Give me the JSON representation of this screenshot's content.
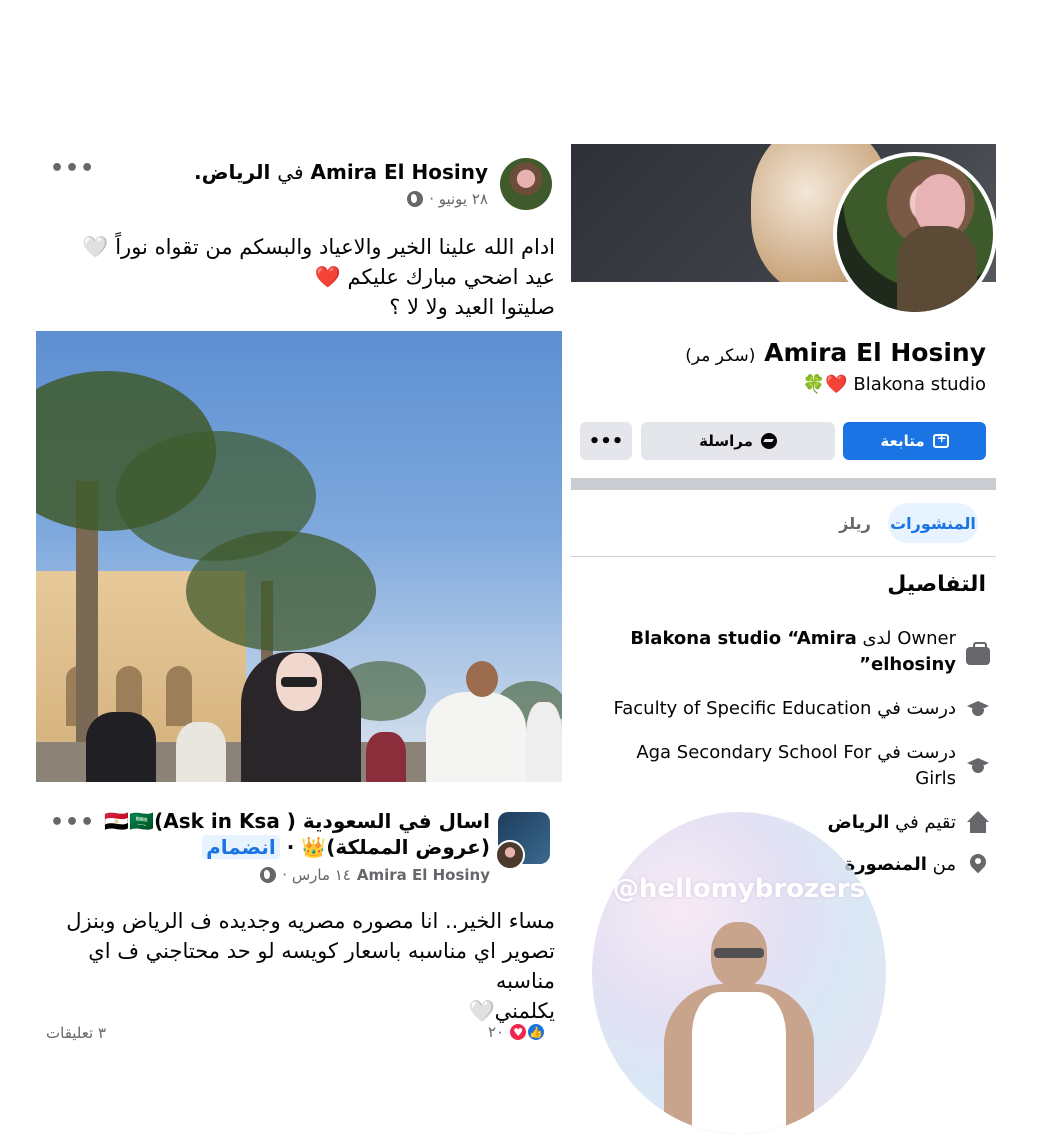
{
  "post1": {
    "author": "Amira El Hosiny",
    "location_prefix": "في",
    "location": "الرياض.",
    "date": "٢٨ يونيو ·",
    "more": "•••",
    "line1": "ادام الله  علينا الخير والاعياد والبسكم من تقواه نوراً",
    "line1_emoji": "🤍",
    "line2": "عيد اضحي مبارك عليكم",
    "line2_emoji": "❤️",
    "line3": "صليتوا العيد ولا لا ؟"
  },
  "post2": {
    "group_name": "اسال في السعودية ( Ask in Ksa)🇪🇬🇸🇦 (عروض المملكة)👑",
    "join_separator": "·",
    "join": "انضمام",
    "author": "Amira El Hosiny",
    "date": "١٤ مارس ·",
    "more": "•••",
    "line1": "مساء الخير.. انا مصوره مصريه وجديده ف الرياض وبنزل",
    "line2": "تصوير اي مناسبه باسعار كويسه لو حد محتاجني ف اي مناسبه",
    "line3": "يكلمني",
    "line3_emoji": "🤍",
    "reaction_count": "٢٠",
    "comments": "٣ تعليقات"
  },
  "profile": {
    "name": "Amira El Hosiny",
    "nickname": "(سكر مر)",
    "bio": "Blakona studio",
    "bio_emoji_heart": "❤️",
    "bio_emoji_clover": "🍀",
    "follow_label": "متابعة",
    "message_label": "مراسلة",
    "more_label": "•••"
  },
  "tabs": {
    "posts": "المنشورات",
    "reels": "ريلز"
  },
  "details": {
    "title": "التفاصيل",
    "work_prefix": "Owner لدى",
    "work_place": "Blakona studio “Amira elhosiny”",
    "edu1_prefix": "درست في",
    "edu1_place": "Faculty of Specific Education",
    "edu2_prefix": "درست في",
    "edu2_place": "Aga Secondary School For Girls",
    "lives_prefix": "تقيم في",
    "lives_place": "الرياض",
    "from_prefix": "من",
    "from_place": "المنصورة"
  },
  "watermark": {
    "handle": "@hellomybrozers"
  },
  "colors": {
    "facebook_blue": "#1b74e4",
    "button_gray": "#e4e6eb",
    "muted_text": "#65676b",
    "love_red": "#f02849"
  },
  "icons": {
    "globe": "globe-icon",
    "briefcase": "briefcase-icon",
    "graduation_cap": "graduation-cap-icon",
    "home": "home-icon",
    "location_pin": "location-pin-icon",
    "messenger": "messenger-icon",
    "follow": "follow-icon"
  }
}
